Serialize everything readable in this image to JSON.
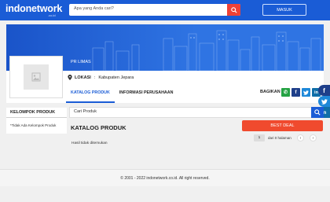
{
  "header": {
    "logo": "indonetwork",
    "logo_sub": ".co.id",
    "search_placeholder": "Apa yang Anda cari?",
    "login_label": "MASUK"
  },
  "company": {
    "name": "PR LIMAS",
    "location_label": "LOKASI",
    "location_sep": ":",
    "location_value": "Kabupaten Jepara",
    "tabs": [
      {
        "label": "KATALOG PRODUK",
        "active": true
      },
      {
        "label": "INFORMASI PERUSAHAAN",
        "active": false
      }
    ],
    "share_label": "BAGIKAN :",
    "share_buttons": [
      {
        "name": "whatsapp-icon",
        "glyph": "✆",
        "color": "#25a244"
      },
      {
        "name": "facebook-icon",
        "glyph": "f",
        "color": "#1e3f8a"
      },
      {
        "name": "twitter-icon",
        "glyph": "🐦",
        "color": "#1e88d8"
      },
      {
        "name": "linkedin-icon",
        "glyph": "in",
        "color": "#0f6ea8"
      }
    ]
  },
  "floating_share": [
    {
      "name": "float-facebook-icon",
      "glyph": "f",
      "color": "#1e3f8a"
    },
    {
      "name": "float-twitter-icon",
      "glyph": "🐦",
      "color": "#1e88d8"
    },
    {
      "name": "float-linkedin-icon",
      "glyph": "in",
      "color": "#0f6ea8"
    }
  ],
  "sidebar": {
    "title": "KELOMPOK PRODUK",
    "empty_text": "*Tidak Ada Kelompok Produk"
  },
  "catalog": {
    "search_placeholder": "Cari Produk",
    "title": "KATALOG PRODUK",
    "best_deal_label": "BEST DEAL",
    "no_result": "Hasil tidak ditemukan",
    "pagination": {
      "current_page": "1",
      "info": "dari 0 halaman",
      "prev": "‹",
      "next": "›"
    }
  },
  "footer": {
    "copyright": "© 2001 - 2022 indonetwork.co.id. All right reserved."
  },
  "colors": {
    "brand_blue": "#1a5cd6",
    "search_red": "#ef4136",
    "best_deal": "#f04a2e"
  }
}
